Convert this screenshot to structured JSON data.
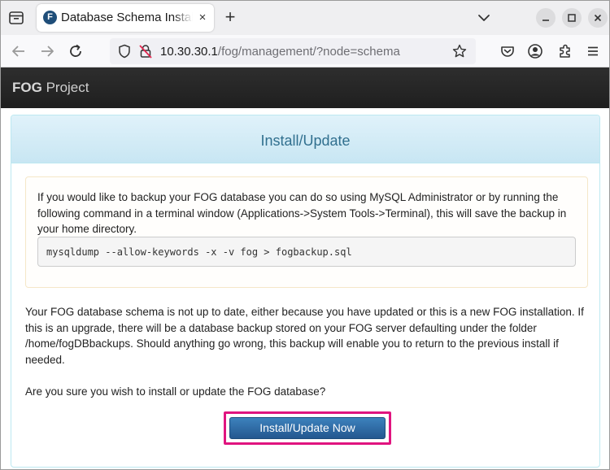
{
  "browser": {
    "tab": {
      "favicon_letter": "F",
      "title": "Database Schema Installer",
      "close_glyph": "×"
    },
    "new_tab_glyph": "+",
    "url": {
      "host": "10.30.30.1",
      "path": "/fog/management/?node=schema"
    },
    "icons": {
      "tab_list": "tab-list-icon",
      "back": "back-arrow-icon",
      "forward": "forward-arrow-icon",
      "reload": "reload-icon",
      "shield": "tracking-protection-shield-icon",
      "insecure": "insecure-lock-icon",
      "bookmark": "star-icon",
      "pocket": "pocket-icon",
      "account": "account-icon",
      "extensions": "puzzle-icon",
      "menu": "hamburger-menu-icon",
      "minimize": "minimize-icon",
      "maximize": "maximize-icon",
      "close": "close-window-icon"
    }
  },
  "page": {
    "brand": {
      "bold": "FOG",
      "rest": " Project"
    },
    "panel_title": "Install/Update",
    "backup_text": "If you would like to backup your FOG database you can do so using MySQL Administrator or by running the following command in a terminal window (Applications->System Tools->Terminal), this will save the backup in your home directory.",
    "backup_command": "mysqldump --allow-keywords -x -v fog > fogbackup.sql",
    "schema_text": "Your FOG database schema is not up to date, either because you have updated or this is a new FOG installation. If this is an upgrade, there will be a database backup stored on your FOG server defaulting under the folder /home/fogDBbackups. Should anything go wrong, this backup will enable you to return to the previous install if needed.",
    "confirm_text": "Are you sure you wish to install or update the FOG database?",
    "install_button": "Install/Update Now"
  },
  "colors": {
    "panel_title": "#31708f",
    "header_bg": "#2a2a2a",
    "button_bg": "#2f6aa6",
    "highlight_border": "#e0147f"
  }
}
